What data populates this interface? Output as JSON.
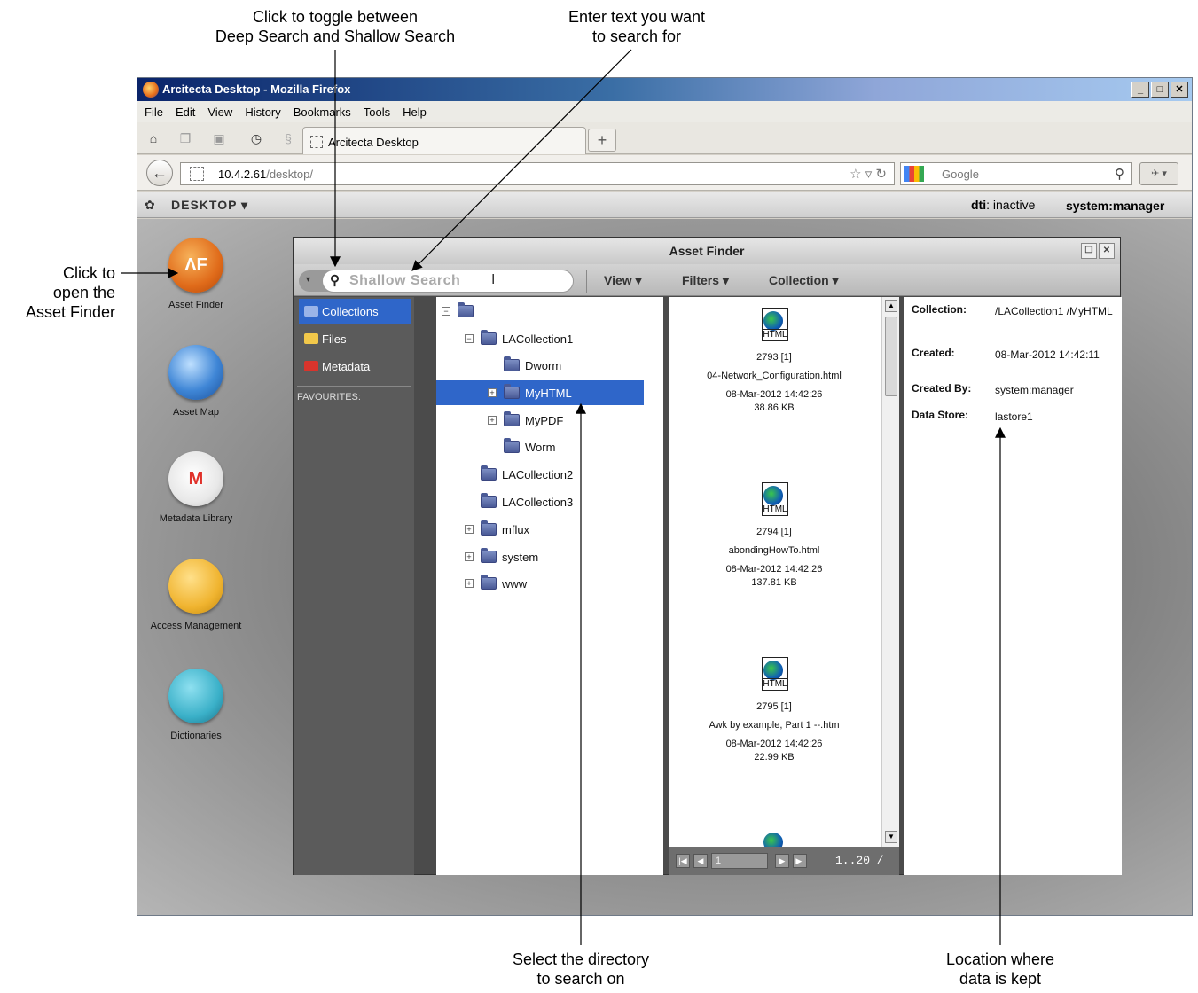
{
  "annotations": {
    "toggle_search": [
      "Click to toggle between",
      "Deep Search and Shallow Search"
    ],
    "enter_text": [
      "Enter text you want",
      "to search for"
    ],
    "open_finder": [
      "Click to",
      "open the",
      "Asset Finder"
    ],
    "select_dir": [
      "Select the directory",
      "to search on"
    ],
    "location": [
      "Location where",
      "data is kept"
    ]
  },
  "browser": {
    "title": "Arcitecta Desktop - Mozilla Firefox",
    "menus": [
      "File",
      "Edit",
      "View",
      "History",
      "Bookmarks",
      "Tools",
      "Help"
    ],
    "tab_title": "Arcitecta Desktop",
    "url_host": "10.4.2.61",
    "url_path": "/desktop/",
    "search_placeholder": "Google"
  },
  "appbar": {
    "desktop_label": "DESKTOP",
    "dti_label": "dti",
    "dti_status": ": inactive",
    "user": "system:manager"
  },
  "desktop_icons": [
    {
      "label": "Asset Finder",
      "icon": "asset-finder-icon",
      "mark": "ΛF"
    },
    {
      "label": "Asset Map",
      "icon": "globe-icon",
      "mark": ""
    },
    {
      "label": "Metadata Library",
      "icon": "metadata-library-icon",
      "mark": "M"
    },
    {
      "label": "Access Management",
      "icon": "access-management-icon",
      "mark": ""
    },
    {
      "label": "Dictionaries",
      "icon": "dictionary-icon",
      "mark": ""
    }
  ],
  "asset_finder": {
    "title": "Asset Finder",
    "search_placeholder": "Shallow Search",
    "menus": {
      "view": "View",
      "filters": "Filters",
      "collection": "Collection"
    },
    "left_items": [
      "Collections",
      "Files",
      "Metadata"
    ],
    "favourites_label": "FAVOURITES:",
    "tree": [
      {
        "label": "",
        "expander": "−"
      },
      {
        "label": "LACollection1",
        "expander": "−"
      },
      {
        "label": "Dworm",
        "expander": ""
      },
      {
        "label": "MyHTML",
        "expander": "+",
        "selected": true
      },
      {
        "label": "MyPDF",
        "expander": "+"
      },
      {
        "label": "Worm",
        "expander": ""
      },
      {
        "label": "LACollection2",
        "expander": ""
      },
      {
        "label": "LACollection3",
        "expander": ""
      },
      {
        "label": "mflux",
        "expander": "+"
      },
      {
        "label": "system",
        "expander": "+"
      },
      {
        "label": "www",
        "expander": "+"
      }
    ],
    "files": [
      {
        "id": "2793 [1]",
        "name": "04-Network_Configuration.html",
        "date": "08-Mar-2012 14:42:26",
        "size": "38.86 KB"
      },
      {
        "id": "2794 [1]",
        "name": "abondingHowTo.html",
        "date": "08-Mar-2012 14:42:26",
        "size": "137.81 KB"
      },
      {
        "id": "2795 [1]",
        "name": "Awk by example, Part 1 --.htm",
        "date": "08-Mar-2012 14:42:26",
        "size": "22.99 KB"
      }
    ],
    "file_icon_label": "HTML",
    "pager": {
      "page": "1",
      "range": "1..20 /"
    },
    "details": {
      "collection_key": "Collection:",
      "collection_val": "/LACollection1 /MyHTML",
      "created_key": "Created:",
      "created_val": "08-Mar-2012 14:42:11",
      "created_by_key": "Created By:",
      "created_by_val": "system:manager",
      "data_store_key": "Data Store:",
      "data_store_val": "lastore1"
    }
  }
}
